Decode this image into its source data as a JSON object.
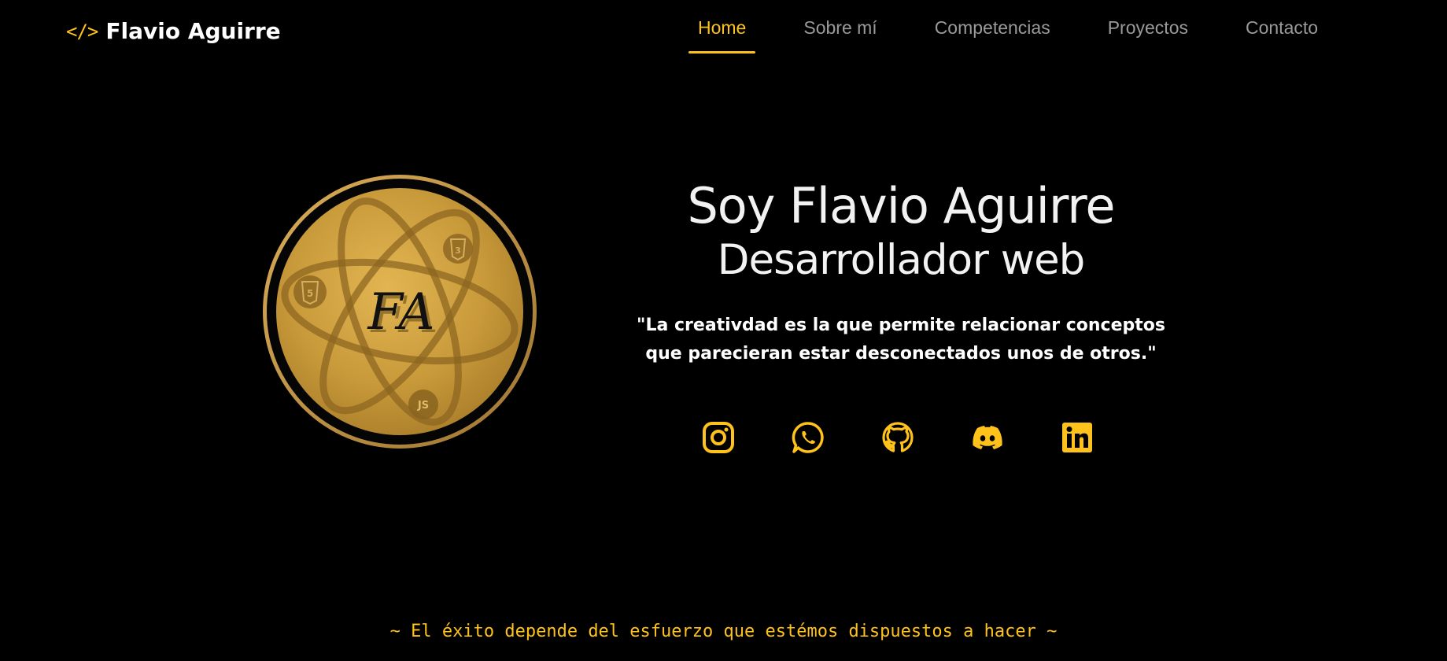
{
  "brand": {
    "icon": "code-icon",
    "icon_glyph": "</>",
    "name": "Flavio Aguirre"
  },
  "nav": [
    {
      "label": "Home",
      "active": true
    },
    {
      "label": "Sobre mí",
      "active": false
    },
    {
      "label": "Competencias",
      "active": false
    },
    {
      "label": "Proyectos",
      "active": false
    },
    {
      "label": "Contacto",
      "active": false
    }
  ],
  "hero": {
    "title": "Soy Flavio Aguirre",
    "subtitle": "Desarrollador web",
    "quote": "\"La creativdad es la que permite relacionar conceptos que parecieran estar desconectados unos de otros.\"",
    "logo_monogram": "FA",
    "logo_badges": [
      "HTML5",
      "CSS3",
      "JS"
    ]
  },
  "social": [
    {
      "icon": "instagram-icon"
    },
    {
      "icon": "whatsapp-icon"
    },
    {
      "icon": "github-icon"
    },
    {
      "icon": "discord-icon"
    },
    {
      "icon": "linkedin-icon"
    }
  ],
  "footer": {
    "motto": "~ El éxito depende del esfuerzo que estémos dispuestos a hacer ~"
  },
  "colors": {
    "background": "#000000",
    "accent": "#ffc21a",
    "text": "#f2f2f2",
    "nav_inactive": "#9a9a9a"
  }
}
